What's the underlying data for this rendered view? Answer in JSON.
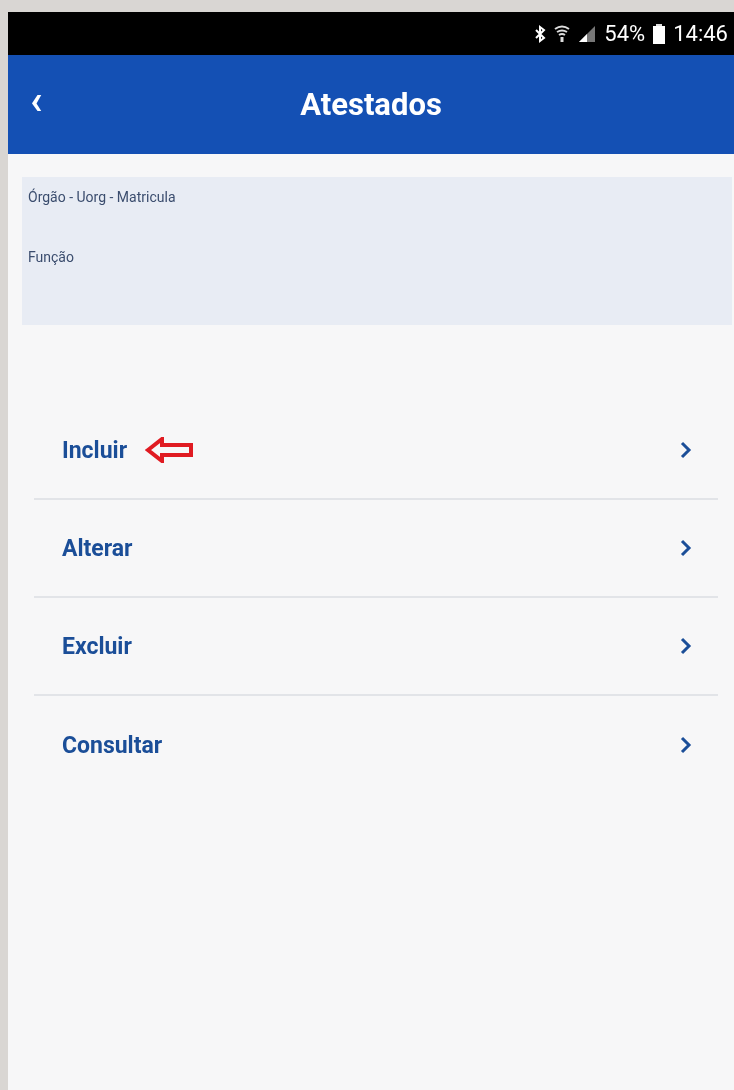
{
  "status_bar": {
    "battery": "54%",
    "time": "14:46"
  },
  "header": {
    "back": "‹",
    "title": "Atestados"
  },
  "info_card": {
    "lines": [
      "Órgão - Uorg - Matricula",
      "Função"
    ]
  },
  "menu": [
    {
      "label": "Incluir",
      "annotated": true
    },
    {
      "label": "Alterar",
      "annotated": false
    },
    {
      "label": "Excluir",
      "annotated": false
    },
    {
      "label": "Consultar",
      "annotated": false
    }
  ]
}
